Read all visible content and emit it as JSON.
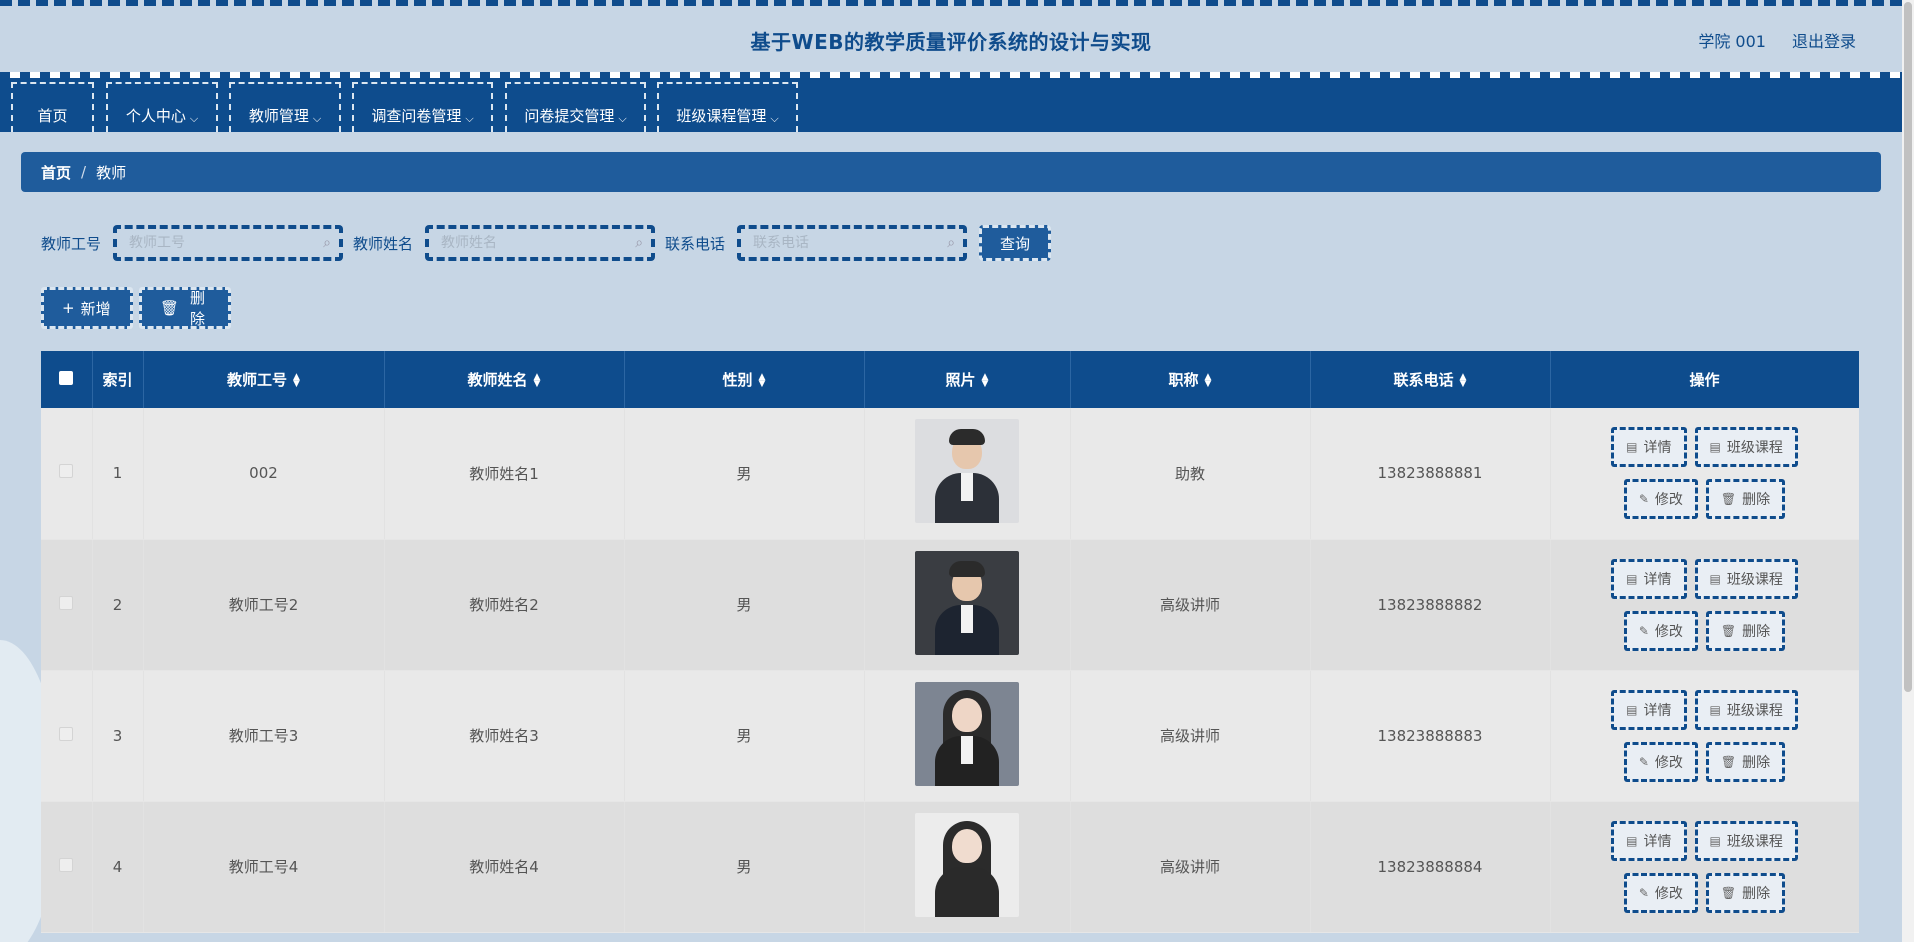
{
  "header": {
    "title": "基于WEB的教学质量评价系统的设计与实现",
    "user": "学院 001",
    "logout": "退出登录"
  },
  "nav": [
    {
      "label": "首页",
      "has_menu": false
    },
    {
      "label": "个人中心",
      "has_menu": true
    },
    {
      "label": "教师管理",
      "has_menu": true
    },
    {
      "label": "调查问卷管理",
      "has_menu": true
    },
    {
      "label": "问卷提交管理",
      "has_menu": true
    },
    {
      "label": "班级课程管理",
      "has_menu": true
    }
  ],
  "breadcrumb": {
    "home": "首页",
    "separator": "/",
    "current": "教师"
  },
  "search": {
    "fields": [
      {
        "label": "教师工号",
        "placeholder": "教师工号"
      },
      {
        "label": "教师姓名",
        "placeholder": "教师姓名"
      },
      {
        "label": "联系电话",
        "placeholder": "联系电话"
      }
    ],
    "query_label": "查询"
  },
  "toolbar": {
    "add_label": "新增",
    "delete_label": "删除"
  },
  "table": {
    "columns": [
      "索引",
      "教师工号",
      "教师姓名",
      "性别",
      "照片",
      "职称",
      "联系电话",
      "操作"
    ],
    "rows": [
      {
        "index": "1",
        "id": "002",
        "name": "教师姓名1",
        "gender": "男",
        "title": "助教",
        "phone": "13823888881"
      },
      {
        "index": "2",
        "id": "教师工号2",
        "name": "教师姓名2",
        "gender": "男",
        "title": "高级讲师",
        "phone": "13823888882"
      },
      {
        "index": "3",
        "id": "教师工号3",
        "name": "教师姓名3",
        "gender": "男",
        "title": "高级讲师",
        "phone": "13823888883"
      },
      {
        "index": "4",
        "id": "教师工号4",
        "name": "教师姓名4",
        "gender": "男",
        "title": "高级讲师",
        "phone": "13823888884"
      }
    ],
    "row_actions": {
      "detail": "详情",
      "class_course": "班级课程",
      "edit": "修改",
      "delete": "删除"
    }
  },
  "colors": {
    "primary": "#0e4c8d",
    "background": "#c7d6e5",
    "accent": "#1f5c9c"
  }
}
